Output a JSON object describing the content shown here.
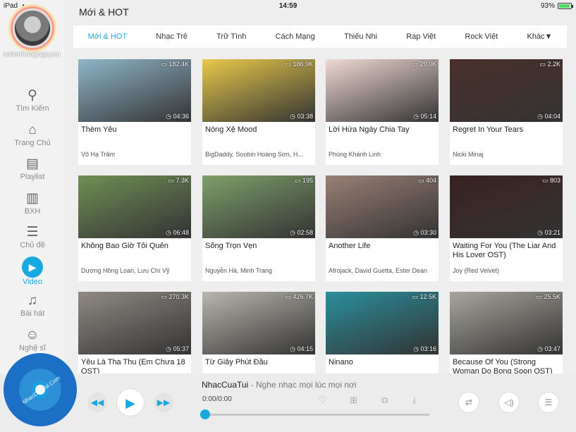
{
  "status": {
    "device": "iPad",
    "time": "14:59",
    "battery": "93%"
  },
  "sidebar": {
    "username": "satienhangnguyen",
    "items": [
      {
        "label": "Tìm Kiếm",
        "icon": "search-icon",
        "glyph": "⚲"
      },
      {
        "label": "Trang Chủ",
        "icon": "home-icon",
        "glyph": "⌂"
      },
      {
        "label": "Playlist",
        "icon": "playlist-icon",
        "glyph": "▤"
      },
      {
        "label": "BXH",
        "icon": "chart-icon",
        "glyph": "▥"
      },
      {
        "label": "Chủ đề",
        "icon": "topic-icon",
        "glyph": "☰"
      },
      {
        "label": "Video",
        "icon": "video-icon",
        "glyph": "▶"
      },
      {
        "label": "Bài hát",
        "icon": "music-note-icon",
        "glyph": "♫"
      },
      {
        "label": "Nghệ sĩ",
        "icon": "artist-icon",
        "glyph": "☺"
      }
    ]
  },
  "header": {
    "title": "Mới & HOT"
  },
  "tabs": [
    "Mới & HOT",
    "Nhạc Trẻ",
    "Trữ Tình",
    "Cách Mạng",
    "Thiếu Nhi",
    "Rap Việt",
    "Rock Việt",
    "Khác▼"
  ],
  "videos": [
    {
      "title": "Thèm Yêu",
      "artist": "Võ Hạ Trâm",
      "views": "182.4K",
      "duration": "04:36",
      "color": "#8fb6c9"
    },
    {
      "title": "Nóng Xệ Mood",
      "artist": "BigDaddy, Soobin Hoàng Sơn, H...",
      "views": "186.9K",
      "duration": "03:38",
      "color": "#e7c94a"
    },
    {
      "title": "Lời Hứa Ngày Chia Tay",
      "artist": "Phùng Khánh Linh",
      "views": "29.0K",
      "duration": "05:14",
      "color": "#f0d9d3"
    },
    {
      "title": "Regret In Your Tears",
      "artist": "Nicki Minaj",
      "views": "2.2K",
      "duration": "04:04",
      "color": "#4a2f2a"
    },
    {
      "title": "Không Bao Giờ Tôi Quên",
      "artist": "Dương Hồng Loan, Lưu Chí Vỹ",
      "views": "7.3K",
      "duration": "06:48",
      "color": "#6f8f55"
    },
    {
      "title": "Sống Trọn Vẹn",
      "artist": "Nguyễn Hà, Minh Trang",
      "views": "195",
      "duration": "02:58",
      "color": "#7da06a"
    },
    {
      "title": "Another Life",
      "artist": "Afrojack, David Guetta, Ester Dean",
      "views": "404",
      "duration": "03:30",
      "color": "#9a7f74"
    },
    {
      "title": "Waiting For You (The Liar And His Lover OST)",
      "artist": "Joy (Red Velvet)",
      "views": "803",
      "duration": "03:21",
      "color": "#3a2220"
    },
    {
      "title": "Yêu Là Tha Thu (Em Chưa 18 OST)",
      "artist": "",
      "views": "270.3K",
      "duration": "05:37",
      "color": "#8f8a84"
    },
    {
      "title": "Từ Giây Phút Đầu",
      "artist": "",
      "views": "426.7K",
      "duration": "04:15",
      "color": "#b9b6ad"
    },
    {
      "title": "Ninano",
      "artist": "",
      "views": "12.5K",
      "duration": "03:16",
      "color": "#2a8f9c"
    },
    {
      "title": "Because Of You (Strong Woman Do Bong Soon OST)",
      "artist": "",
      "views": "25.5K",
      "duration": "03:47",
      "color": "#a8a59c"
    }
  ],
  "player": {
    "disc_text": "NhacCuaTui.Com",
    "name": "NhacCuaTui",
    "separator": " - ",
    "tagline": "Nghe nhạc mọi lúc mọi nơi",
    "time": "0:00/0:00",
    "progress": 0
  },
  "glyphs": {
    "wifi": "◔",
    "prev": "◀◀",
    "play": "▶",
    "next": "▶▶",
    "heart": "♡",
    "add": "⊞",
    "share": "⧉",
    "download": "⤓",
    "shuffle": "⇄",
    "volume": "◁)",
    "queue": "☰"
  }
}
